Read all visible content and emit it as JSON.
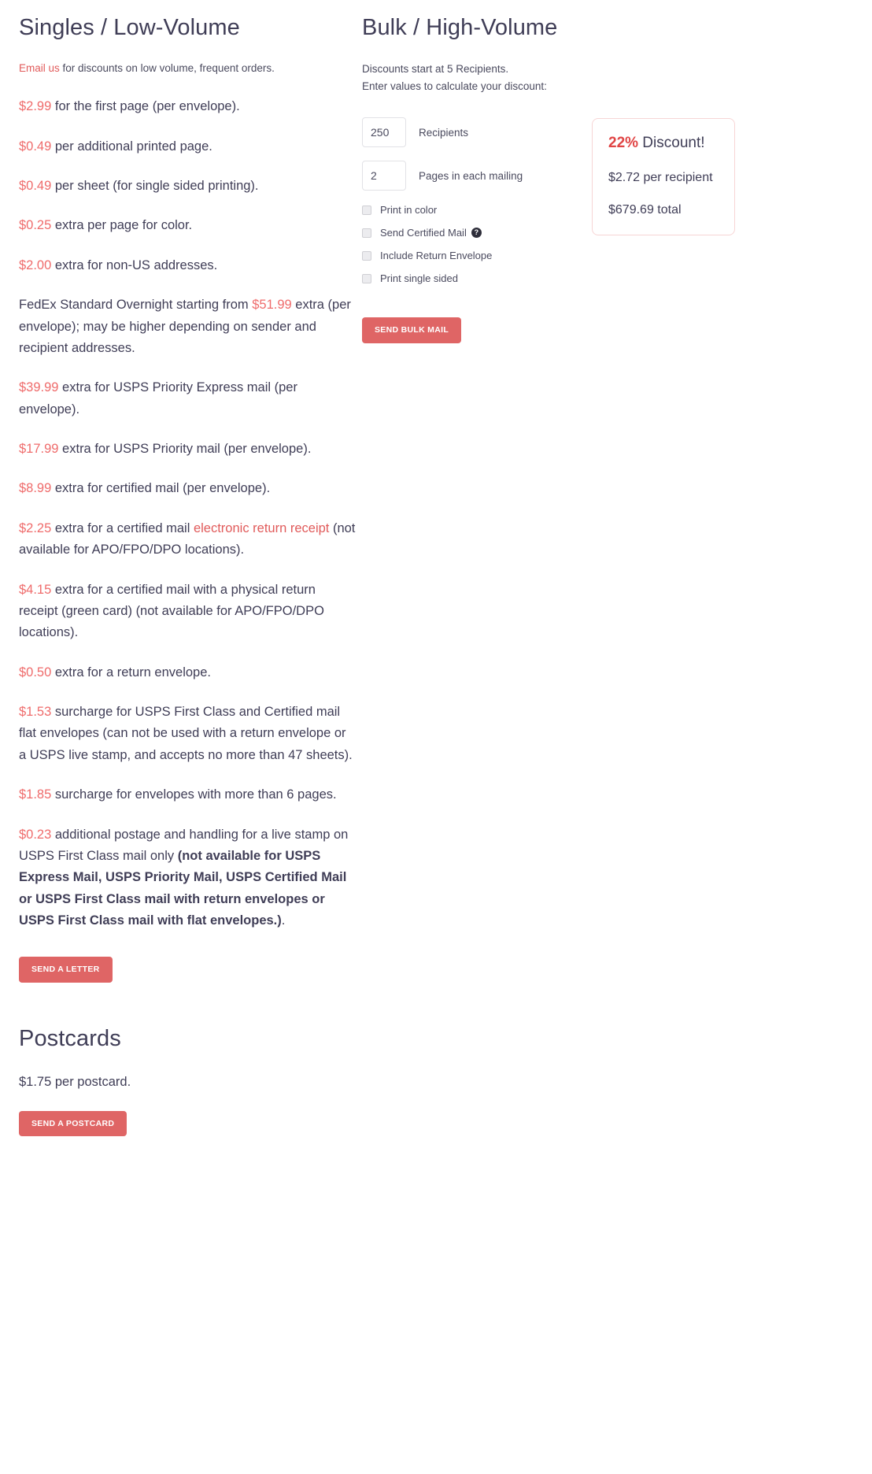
{
  "singles": {
    "title": "Singles / Low-Volume",
    "intro": {
      "link_text": "Email us",
      "rest": " for discounts on low volume, frequent orders."
    },
    "items": [
      {
        "amount": "$2.99",
        "text": " for the first page (per envelope)."
      },
      {
        "amount": "$0.49",
        "text": " per additional printed page."
      },
      {
        "amount": "$0.49",
        "text": " per sheet (for single sided printing)."
      },
      {
        "amount": "$0.25",
        "text": " extra per page for color."
      },
      {
        "amount": "$2.00",
        "text": " extra for non-US addresses."
      },
      {
        "amount": "$39.99",
        "text": " extra for USPS Priority Express mail (per envelope)."
      },
      {
        "amount": "$17.99",
        "text": " extra for USPS Priority mail (per envelope)."
      },
      {
        "amount": "$8.99",
        "text": " extra for certified mail (per envelope)."
      },
      {
        "amount": "$0.50",
        "text": " extra for a return envelope."
      },
      {
        "amount": "$1.53",
        "text": " surcharge for USPS First Class and Certified mail flat envelopes (can not be used with a return envelope or a USPS live stamp, and accepts no more than 47 sheets)."
      },
      {
        "amount": "$1.85",
        "text": " surcharge for envelopes with more than 6 pages."
      }
    ],
    "fedex": {
      "lead": "FedEx Standard Overnight starting from ",
      "amount": "$51.99",
      "rest": " extra (per envelope); may be higher depending on sender and recipient addresses."
    },
    "electronic_receipt": {
      "amount": "$2.25",
      "pre": " extra for a certified mail ",
      "link_text": "electronic return receipt",
      "post": " (not available for APO/FPO/DPO locations)."
    },
    "physical_receipt": {
      "amount": "$4.15",
      "text": " extra for a certified mail with a physical return receipt (green card) (not available for APO/FPO/DPO locations)."
    },
    "live_stamp": {
      "amount": "$0.23",
      "normal": " additional postage and handling for a live stamp on USPS First Class mail only ",
      "bold": "(not available for USPS Express Mail, USPS Priority Mail, USPS Certified Mail or USPS First Class mail with return envelopes or USPS First Class mail with flat envelopes.)",
      "tail": "."
    },
    "send_letter_button": "SEND A LETTER"
  },
  "postcards": {
    "title": "Postcards",
    "price_line": "$1.75 per postcard.",
    "send_postcard_button": "SEND A POSTCARD"
  },
  "bulk": {
    "title": "Bulk / High-Volume",
    "intro_line1": "Discounts start at 5 Recipients.",
    "intro_line2": "Enter values to calculate your discount:",
    "fields": [
      {
        "name": "recipients",
        "value": "250",
        "label": "Recipients"
      },
      {
        "name": "pages",
        "value": "2",
        "label": "Pages in each mailing"
      }
    ],
    "checkboxes": [
      {
        "name": "print-in-color",
        "label": "Print in color",
        "checked": false,
        "help": false
      },
      {
        "name": "send-certified-mail",
        "label": "Send Certified Mail",
        "checked": false,
        "help": true
      },
      {
        "name": "include-return-envelope",
        "label": "Include Return Envelope",
        "checked": false,
        "help": false
      },
      {
        "name": "print-single-sided",
        "label": "Print single sided",
        "checked": false,
        "help": false
      }
    ],
    "help_icon_glyph": "?",
    "send_bulk_button": "SEND BULK MAIL",
    "result": {
      "percent": "22%",
      "discount_label": " Discount!",
      "per_recipient": "$2.72 per recipient",
      "total": "$679.69 total"
    }
  },
  "colors": {
    "accent_red": "#ef6b6b",
    "button_red": "#df6565",
    "discount_red": "#e04545",
    "text_dark": "#3f3d56",
    "box_border_pink": "#f7d5d5"
  }
}
